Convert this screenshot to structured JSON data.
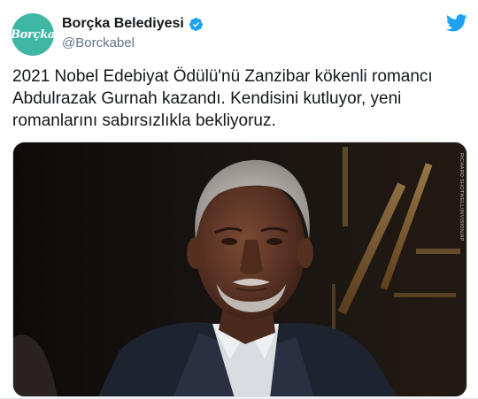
{
  "author": {
    "display_name": "Borçka Belediyesi",
    "handle": "@Borckabel",
    "avatar_text": "Borçka",
    "verified": true
  },
  "tweet": {
    "lines": [
      "2021 Nobel Edebiyat Ödülü'nü Zanzibar kökenli romancı",
      "Abdulrazak Gurnah kazandı. Kendisini kutluyor, yeni",
      "romanlarını sabırsızlıkla bekliyoruz."
    ]
  },
  "media": {
    "credit": "RICHARD SHOTWELL/INVISION/AP"
  },
  "icons": {
    "verified": "verified-badge-icon",
    "brand": "twitter-bird-icon"
  },
  "colors": {
    "accent": "#1da1f2",
    "avatar_bg": "#3fb7a5",
    "handle": "#657786"
  }
}
